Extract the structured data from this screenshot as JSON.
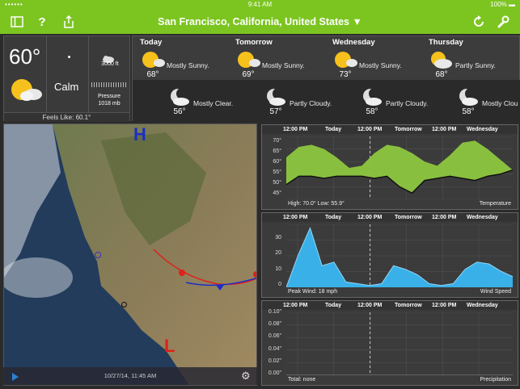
{
  "status_bar": {
    "left": "•••••• ",
    "time": "9:41 AM",
    "battery": "100%"
  },
  "nav": {
    "title": "San Francisco, California, United States ▼",
    "help": "?"
  },
  "current": {
    "temp": "60°",
    "wind": "Calm",
    "cloud_alt": "3000 ft",
    "pressure_label": "Pressure",
    "pressure_value": "1018 mb",
    "feels_like": "Feels Like:  60.1°"
  },
  "forecast": {
    "days": [
      {
        "name": "Today",
        "desc": "Mostly Sunny.",
        "temp": "68°"
      },
      {
        "name": "Tomorrow",
        "desc": "Mostly Sunny.",
        "temp": "69°"
      },
      {
        "name": "Wednesday",
        "desc": "Mostly Sunny.",
        "temp": "73°"
      },
      {
        "name": "Thursday",
        "desc": "Partly Sunny.",
        "temp": "68°"
      }
    ],
    "nights": [
      {
        "desc": "Mostly Clear.",
        "temp": "56°"
      },
      {
        "desc": "Partly Cloudy.",
        "temp": "57°"
      },
      {
        "desc": "Partly Cloudy.",
        "temp": "58°"
      },
      {
        "desc": "Mostly Clou",
        "temp": "58°"
      }
    ]
  },
  "timeline": {
    "labels": [
      "12:00 PM",
      "Today",
      "12:00 PM",
      "Tomorrow",
      "12:00 PM",
      "Wednesday"
    ]
  },
  "temperature_chart": {
    "yticks": [
      "70°",
      "65°",
      "60°",
      "55°",
      "50°",
      "45°"
    ],
    "footer_left": "High: 70.0°     Low: 55.9°",
    "footer_right": "Temperature"
  },
  "wind_chart": {
    "yticks": [
      "30",
      "20",
      "10",
      "0"
    ],
    "footer_left": "Peak Wind: 18 mph",
    "footer_right": "Wind Speed"
  },
  "precip_chart": {
    "yticks": [
      "0.10\"",
      "0.08\"",
      "0.06\"",
      "0.04\"",
      "0.02\"",
      "0.00\""
    ],
    "footer_left": "Total: none",
    "footer_right": "Precipitation"
  },
  "map": {
    "timestamp": "10/27/14, 11:45 AM",
    "high_label": "H",
    "low_label": "L"
  },
  "colors": {
    "accent": "#7cc521",
    "temp_fill": "#8dc63f",
    "wind_fill": "#3ab0e8",
    "front_warm": "#e0201a",
    "front_cold": "#1a2ec8"
  },
  "chart_data": [
    {
      "type": "area",
      "title": "Temperature",
      "series": [
        {
          "name": "High",
          "values": [
            62,
            67,
            68,
            66,
            62,
            57,
            58,
            64,
            68,
            67,
            64,
            60,
            58,
            63,
            69,
            70,
            66,
            61,
            56
          ]
        },
        {
          "name": "Low",
          "values": [
            49,
            53,
            53,
            52,
            53,
            53,
            53,
            52,
            53,
            48,
            45,
            51,
            52,
            53,
            52,
            51,
            53,
            54,
            56
          ]
        }
      ],
      "ylim": [
        45,
        70
      ]
    },
    {
      "type": "area",
      "title": "Wind Speed",
      "series": [
        {
          "name": "Wind",
          "values": [
            0,
            18,
            33,
            12,
            14,
            3,
            2,
            1,
            2,
            12,
            10,
            7,
            2,
            1,
            2,
            10,
            14,
            13,
            9,
            6
          ]
        }
      ],
      "ylim": [
        0,
        35
      ]
    },
    {
      "type": "line",
      "title": "Precipitation",
      "series": [
        {
          "name": "Precipitation",
          "values": [
            0,
            0,
            0,
            0,
            0,
            0,
            0,
            0,
            0,
            0
          ]
        }
      ],
      "ylim": [
        0,
        0.1
      ]
    }
  ]
}
